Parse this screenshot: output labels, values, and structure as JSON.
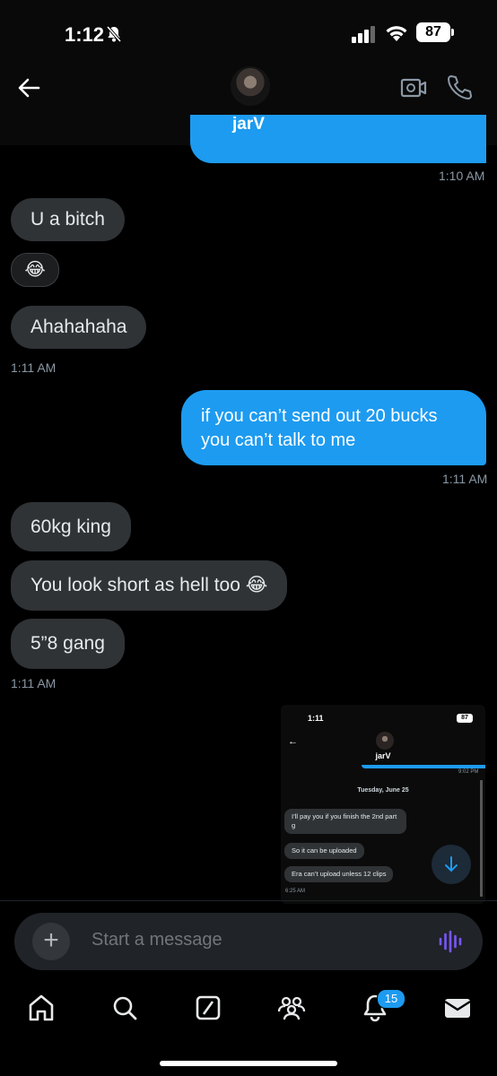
{
  "status_bar": {
    "time": "1:12",
    "battery": "87"
  },
  "header": {
    "contact_name": "jarV"
  },
  "messages": [
    {
      "time": "1:10 AM"
    },
    {
      "text": "U a bitch"
    },
    {
      "emoji": "😂"
    },
    {
      "text": "Ahahahaha"
    },
    {
      "time": "1:11 AM"
    },
    {
      "line1": "if you can’t send out 20 bucks",
      "line2": "you can’t talk to me"
    },
    {
      "time": "1:11 AM"
    },
    {
      "text": "60kg king"
    },
    {
      "text": "You look short as hell too 😂"
    },
    {
      "text": "5”8 gang"
    },
    {
      "time": "1:11 AM"
    }
  ],
  "embedded_screenshot": {
    "time": "1:11",
    "battery": "87",
    "contact_name": "jarV",
    "top_time": "9:02 PM",
    "date": "Tuesday, June 25",
    "messages": [
      "I’ll pay you if you finish the 2nd part g",
      "So it can be uploaded",
      "Era can’t upload unless 12 clips"
    ],
    "bottom_time": "6:25 AM"
  },
  "composer": {
    "placeholder": "Start a message"
  },
  "tab_bar": {
    "notifications_badge": "15"
  },
  "colors": {
    "accent": "#1d9bf0",
    "incoming_bubble": "#2f3336",
    "background": "#000000"
  }
}
